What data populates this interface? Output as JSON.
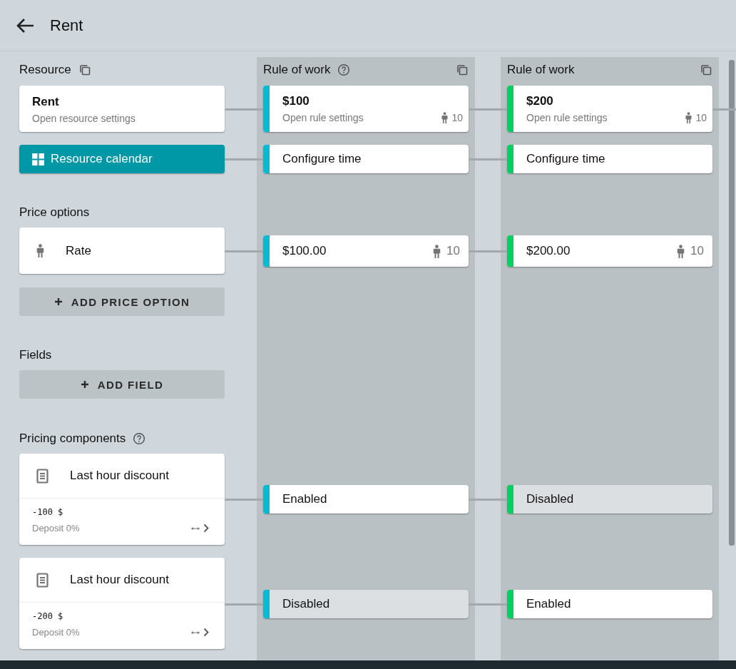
{
  "header": {
    "title": "Rent"
  },
  "resource": {
    "label": "Resource",
    "card": {
      "title": "Rent",
      "subtitle": "Open resource settings"
    },
    "calendar_button": "Resource calendar"
  },
  "price_options": {
    "label": "Price options",
    "items": [
      {
        "name": "Rate"
      }
    ],
    "add_button": "ADD PRICE OPTION"
  },
  "fields": {
    "label": "Fields",
    "add_button": "ADD FIELD"
  },
  "pricing_components": {
    "label": "Pricing components",
    "items": [
      {
        "name": "Last hour discount",
        "amount": "-100 $",
        "deposit": "Deposit 0%"
      },
      {
        "name": "Last hour discount",
        "amount": "-200 $",
        "deposit": "Deposit 0%"
      }
    ]
  },
  "rules": [
    {
      "title": "Rule of work",
      "help": true,
      "color": "#00bcd4",
      "cards": [
        {
          "kind": "settings",
          "title": "$100",
          "subtitle": "Open rule settings",
          "count": "10"
        },
        {
          "kind": "time",
          "label": "Configure time"
        },
        {
          "kind": "price",
          "label": "$100.00",
          "count": "10"
        },
        {
          "kind": "toggle",
          "label": "Enabled",
          "enabled": true
        },
        {
          "kind": "toggle",
          "label": "Disabled",
          "enabled": false
        }
      ]
    },
    {
      "title": "Rule of work",
      "help": false,
      "color": "#00d160",
      "cards": [
        {
          "kind": "settings",
          "title": "$200",
          "subtitle": "Open rule settings",
          "count": "10"
        },
        {
          "kind": "time",
          "label": "Configure time"
        },
        {
          "kind": "price",
          "label": "$200.00",
          "count": "10"
        },
        {
          "kind": "toggle",
          "label": "Disabled",
          "enabled": false
        },
        {
          "kind": "toggle",
          "label": "Enabled",
          "enabled": true
        }
      ]
    }
  ]
}
